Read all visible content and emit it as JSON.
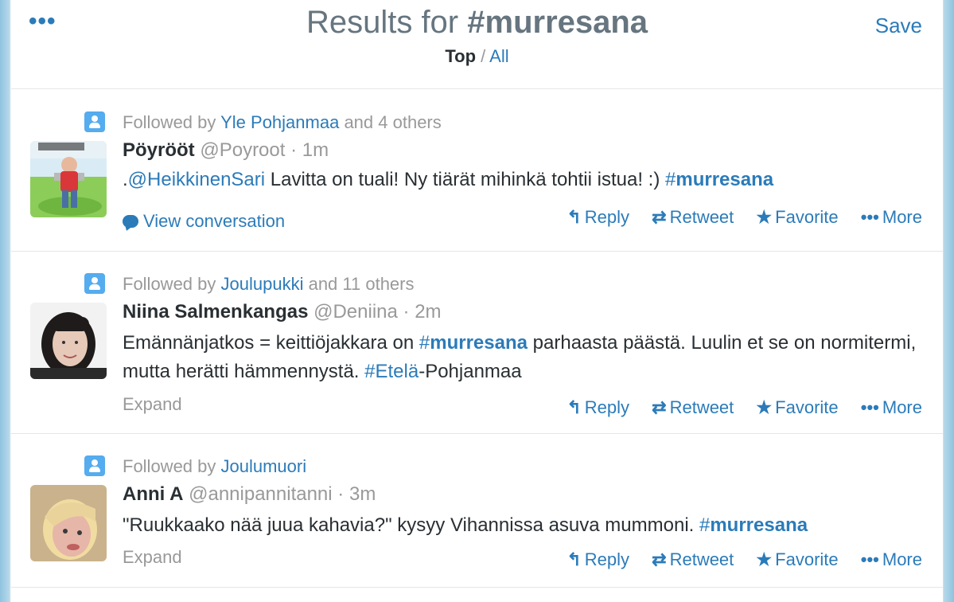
{
  "header": {
    "menu_icon": "•••",
    "title_prefix": "Results for ",
    "title_query": "#murresana",
    "subnav_top": "Top",
    "subnav_sep": " / ",
    "subnav_all": "All",
    "save_label": "Save"
  },
  "actions": {
    "reply": "Reply",
    "retweet": "Retweet",
    "favorite": "Favorite",
    "more": "More",
    "reply_icon": "↰",
    "retweet_icon": "⇄",
    "favorite_icon": "★",
    "more_icon": "•••"
  },
  "tweets": [
    {
      "context_prefix": "Followed by ",
      "context_who": "Yle Pohjanmaa",
      "context_suffix": " and 4 others",
      "fullname": "Pöyrööt",
      "handle": "@Poyroot",
      "time": "1m",
      "text_lead": ".",
      "text_mention": "@HeikkinenSari",
      "text_body": " Lavitta on tuali! Ny tiärät mihinkä tohtii istua! :) ",
      "text_hashtag_mark": "#",
      "text_hashtag_word": "murresana",
      "footer": "View conversation"
    },
    {
      "context_prefix": "Followed by ",
      "context_who": "Joulupukki",
      "context_suffix": " and 11 others",
      "fullname": "Niina Salmenkangas",
      "handle": "@Deniina",
      "time": "2m",
      "text_a": "Emännänjatkos = keittiöjakkara on ",
      "text_hashtag_mark": "#",
      "text_hashtag_word": "murresana",
      "text_b": " parhaasta päästä. Luulin et se on normitermi, mutta herätti hämmennystä. ",
      "text_hashtag2": "#Etelä",
      "text_c": "-Pohjanmaa",
      "footer": "Expand"
    },
    {
      "context_prefix": "Followed by ",
      "context_who": "Joulumuori",
      "context_suffix": "",
      "fullname": "Anni A",
      "handle": "@annipannitanni",
      "time": "3m",
      "text_a": "\"Ruukkaako nää juua kahavia?\" kysyy Vihannissa asuva mummoni. ",
      "text_hashtag_mark": "#",
      "text_hashtag_word": "murresana",
      "footer": "Expand"
    }
  ]
}
